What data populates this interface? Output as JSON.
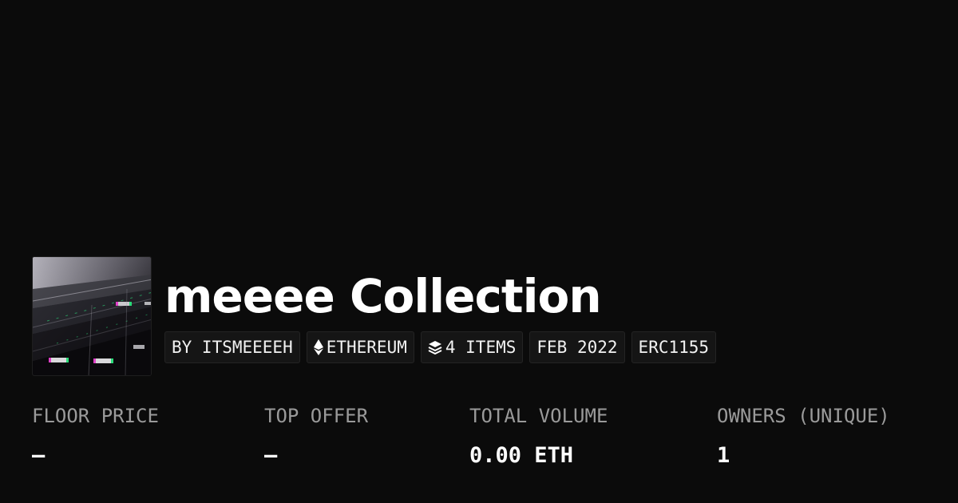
{
  "collection": {
    "title": "meeee Collection",
    "thumbnail_icon": "collection-avatar-image"
  },
  "tags": [
    {
      "label": "BY ITSMEEEEH",
      "icon": null
    },
    {
      "label": "ETHEREUM",
      "icon": "ethereum-icon"
    },
    {
      "label": "4 ITEMS",
      "icon": "layers-icon"
    },
    {
      "label": "FEB 2022",
      "icon": null
    },
    {
      "label": "ERC1155",
      "icon": null
    }
  ],
  "stats": [
    {
      "label": "FLOOR PRICE",
      "value": "–"
    },
    {
      "label": "TOP OFFER",
      "value": "–"
    },
    {
      "label": "TOTAL VOLUME",
      "value": "0.00 ETH"
    },
    {
      "label": "OWNERS (UNIQUE)",
      "value": "1"
    }
  ],
  "colors": {
    "background": "#0b0b0b",
    "text": "#ffffff",
    "muted_text": "#9a9a9a",
    "tag_background": "#151515"
  }
}
